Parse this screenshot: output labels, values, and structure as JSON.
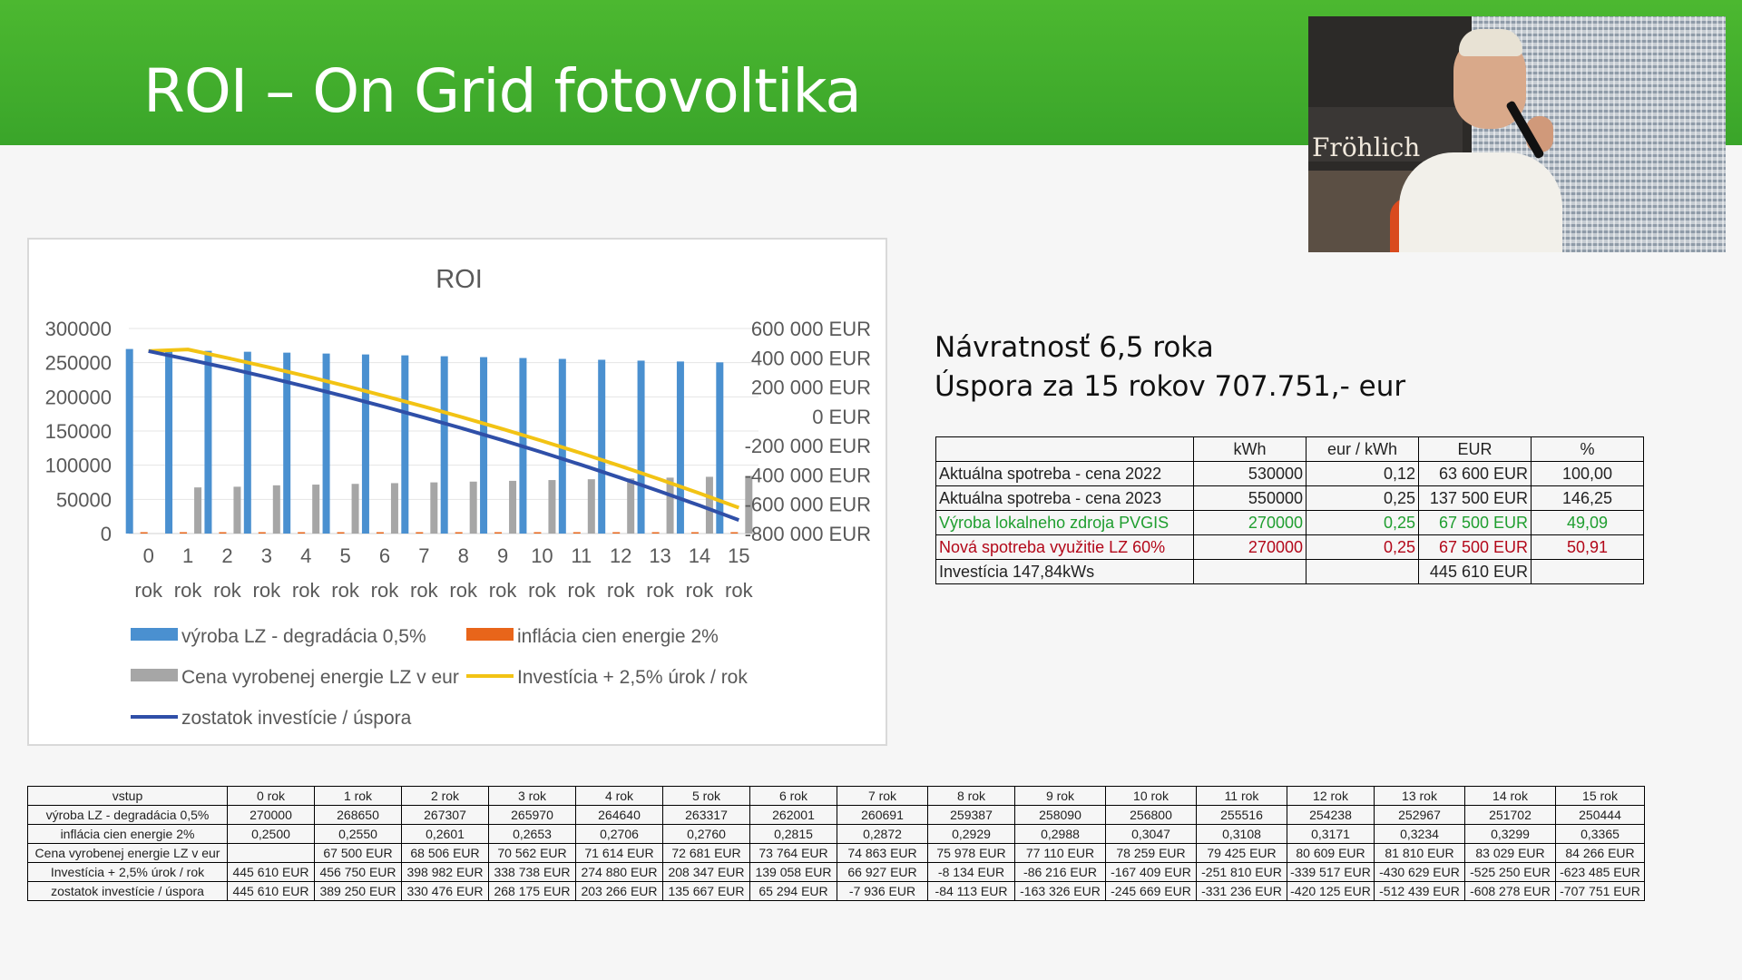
{
  "slide": {
    "title": "ROI – On Grid fotovoltika",
    "thumbnail": {
      "sign_text": "Fröhlich"
    }
  },
  "info": {
    "line1": "Návratnosť 6,5 roka",
    "line2": "Úspora za 15 rokov 707.751,- eur"
  },
  "summary": {
    "headers": [
      "",
      "kWh",
      "eur / kWh",
      "EUR",
      "%"
    ],
    "rows": [
      {
        "label": "Aktuálna spotreba - cena 2022",
        "kwh": "530000",
        "price": "0,12",
        "eur": "63 600 EUR",
        "pct": "100,00",
        "style": ""
      },
      {
        "label": "Aktuálna spotreba - cena 2023",
        "kwh": "550000",
        "price": "0,25",
        "eur": "137 500 EUR",
        "pct": "146,25",
        "style": ""
      },
      {
        "label": "Výroba lokalneho zdroja PVGIS",
        "kwh": "270000",
        "price": "0,25",
        "eur": "67 500 EUR",
        "pct": "49,09",
        "style": "green"
      },
      {
        "label": "Nová spotreba využitie LZ 60%",
        "kwh": "270000",
        "price": "0,25",
        "eur": "67 500 EUR",
        "pct": "50,91",
        "style": "red"
      },
      {
        "label": "Investícia 147,84kWs",
        "kwh": "",
        "price": "",
        "eur": "445 610 EUR",
        "pct": "",
        "style": ""
      }
    ]
  },
  "table": {
    "headers": [
      "vstup",
      "0 rok",
      "1 rok",
      "2 rok",
      "3 rok",
      "4 rok",
      "5 rok",
      "6 rok",
      "7 rok",
      "8 rok",
      "9 rok",
      "10 rok",
      "11 rok",
      "12 rok",
      "13 rok",
      "14 rok",
      "15 rok"
    ],
    "rows": [
      [
        "výroba LZ - degradácia 0,5%",
        "270000",
        "268650",
        "267307",
        "265970",
        "264640",
        "263317",
        "262001",
        "260691",
        "259387",
        "258090",
        "256800",
        "255516",
        "254238",
        "252967",
        "251702",
        "250444"
      ],
      [
        "inflácia cien energie 2%",
        "0,2500",
        "0,2550",
        "0,2601",
        "0,2653",
        "0,2706",
        "0,2760",
        "0,2815",
        "0,2872",
        "0,2929",
        "0,2988",
        "0,3047",
        "0,3108",
        "0,3171",
        "0,3234",
        "0,3299",
        "0,3365"
      ],
      [
        "Cena vyrobenej energie LZ v eur",
        "",
        "67 500 EUR",
        "68 506 EUR",
        "70 562 EUR",
        "71 614 EUR",
        "72 681 EUR",
        "73 764 EUR",
        "74 863 EUR",
        "75 978 EUR",
        "77 110 EUR",
        "78 259 EUR",
        "79 425 EUR",
        "80 609 EUR",
        "81 810 EUR",
        "83 029 EUR",
        "84 266 EUR"
      ],
      [
        "Investícia + 2,5% úrok / rok",
        "445 610 EUR",
        "456 750 EUR",
        "398 982 EUR",
        "338 738 EUR",
        "274 880 EUR",
        "208 347 EUR",
        "139 058 EUR",
        "66 927 EUR",
        "-8 134 EUR",
        "-86 216 EUR",
        "-167 409 EUR",
        "-251 810 EUR",
        "-339 517 EUR",
        "-430 629 EUR",
        "-525 250 EUR",
        "-623 485 EUR"
      ],
      [
        "zostatok investície / úspora",
        "445 610 EUR",
        "389 250 EUR",
        "330 476 EUR",
        "268 175 EUR",
        "203 266 EUR",
        "135 667 EUR",
        "65 294 EUR",
        "-7 936 EUR",
        "-84 113 EUR",
        "-163 326 EUR",
        "-245 669 EUR",
        "-331 236 EUR",
        "-420 125 EUR",
        "-512 439 EUR",
        "-608 278 EUR",
        "-707 751 EUR"
      ]
    ],
    "col_widths": [
      0,
      0
    ]
  },
  "chart_data": {
    "type": "bar",
    "title": "ROI",
    "categories": [
      "0\nrok",
      "1\nrok",
      "2\nrok",
      "3\nrok",
      "4\nrok",
      "5\nrok",
      "6\nrok",
      "7\nrok",
      "8\nrok",
      "9\nrok",
      "10\nrok",
      "11\nrok",
      "12\nrok",
      "13\nrok",
      "14\nrok",
      "15\nrok"
    ],
    "y_left": {
      "ylim": [
        0,
        300000
      ],
      "ticks": [
        "300000",
        "250000",
        "200000",
        "150000",
        "100000",
        "50000",
        "0"
      ]
    },
    "y_right": {
      "ylim": [
        -800000,
        600000
      ],
      "ticks": [
        "600 000 EUR",
        "400 000 EUR",
        "200 000 EUR",
        "0 EUR",
        "-200 000 EUR",
        "-400 000 EUR",
        "-600 000 EUR",
        "-800 000 EUR"
      ]
    },
    "grid": true,
    "legend_position": "bottom",
    "series": [
      {
        "name": "výroba LZ - degradácia 0,5%",
        "kind": "bar",
        "axis": "left",
        "color": "#4a90d0",
        "values": [
          270000,
          268650,
          267307,
          265970,
          264640,
          263317,
          262001,
          260691,
          259387,
          258090,
          256800,
          255516,
          254238,
          252967,
          251702,
          250444
        ]
      },
      {
        "name": "inflácia cien energie 2%",
        "kind": "bar",
        "axis": "left",
        "color": "#e8651a",
        "values": [
          0.25,
          0.255,
          0.2601,
          0.2653,
          0.2706,
          0.276,
          0.2815,
          0.2872,
          0.2929,
          0.2988,
          0.3047,
          0.3108,
          0.3171,
          0.3234,
          0.3299,
          0.3365
        ]
      },
      {
        "name": "Cena vyrobenej energie LZ v eur",
        "kind": "bar",
        "axis": "left",
        "color": "#a6a6a6",
        "values": [
          0,
          67500,
          68506,
          70562,
          71614,
          72681,
          73764,
          74863,
          75978,
          77110,
          78259,
          79425,
          80609,
          81810,
          83029,
          84266
        ]
      },
      {
        "name": "Investícia + 2,5% úrok / rok",
        "kind": "line",
        "axis": "right",
        "color": "#f2c314",
        "values": [
          445610,
          456750,
          398982,
          338738,
          274880,
          208347,
          139058,
          66927,
          -8134,
          -86216,
          -167409,
          -251810,
          -339517,
          -430629,
          -525250,
          -623485
        ]
      },
      {
        "name": "zostatok investície / úspora",
        "kind": "line",
        "axis": "right",
        "color": "#2f4fa8",
        "values": [
          445610,
          389250,
          330476,
          268175,
          203266,
          135667,
          65294,
          -7936,
          -84113,
          -163326,
          -245669,
          -331236,
          -420125,
          -512439,
          -608278,
          -707751
        ]
      }
    ]
  }
}
